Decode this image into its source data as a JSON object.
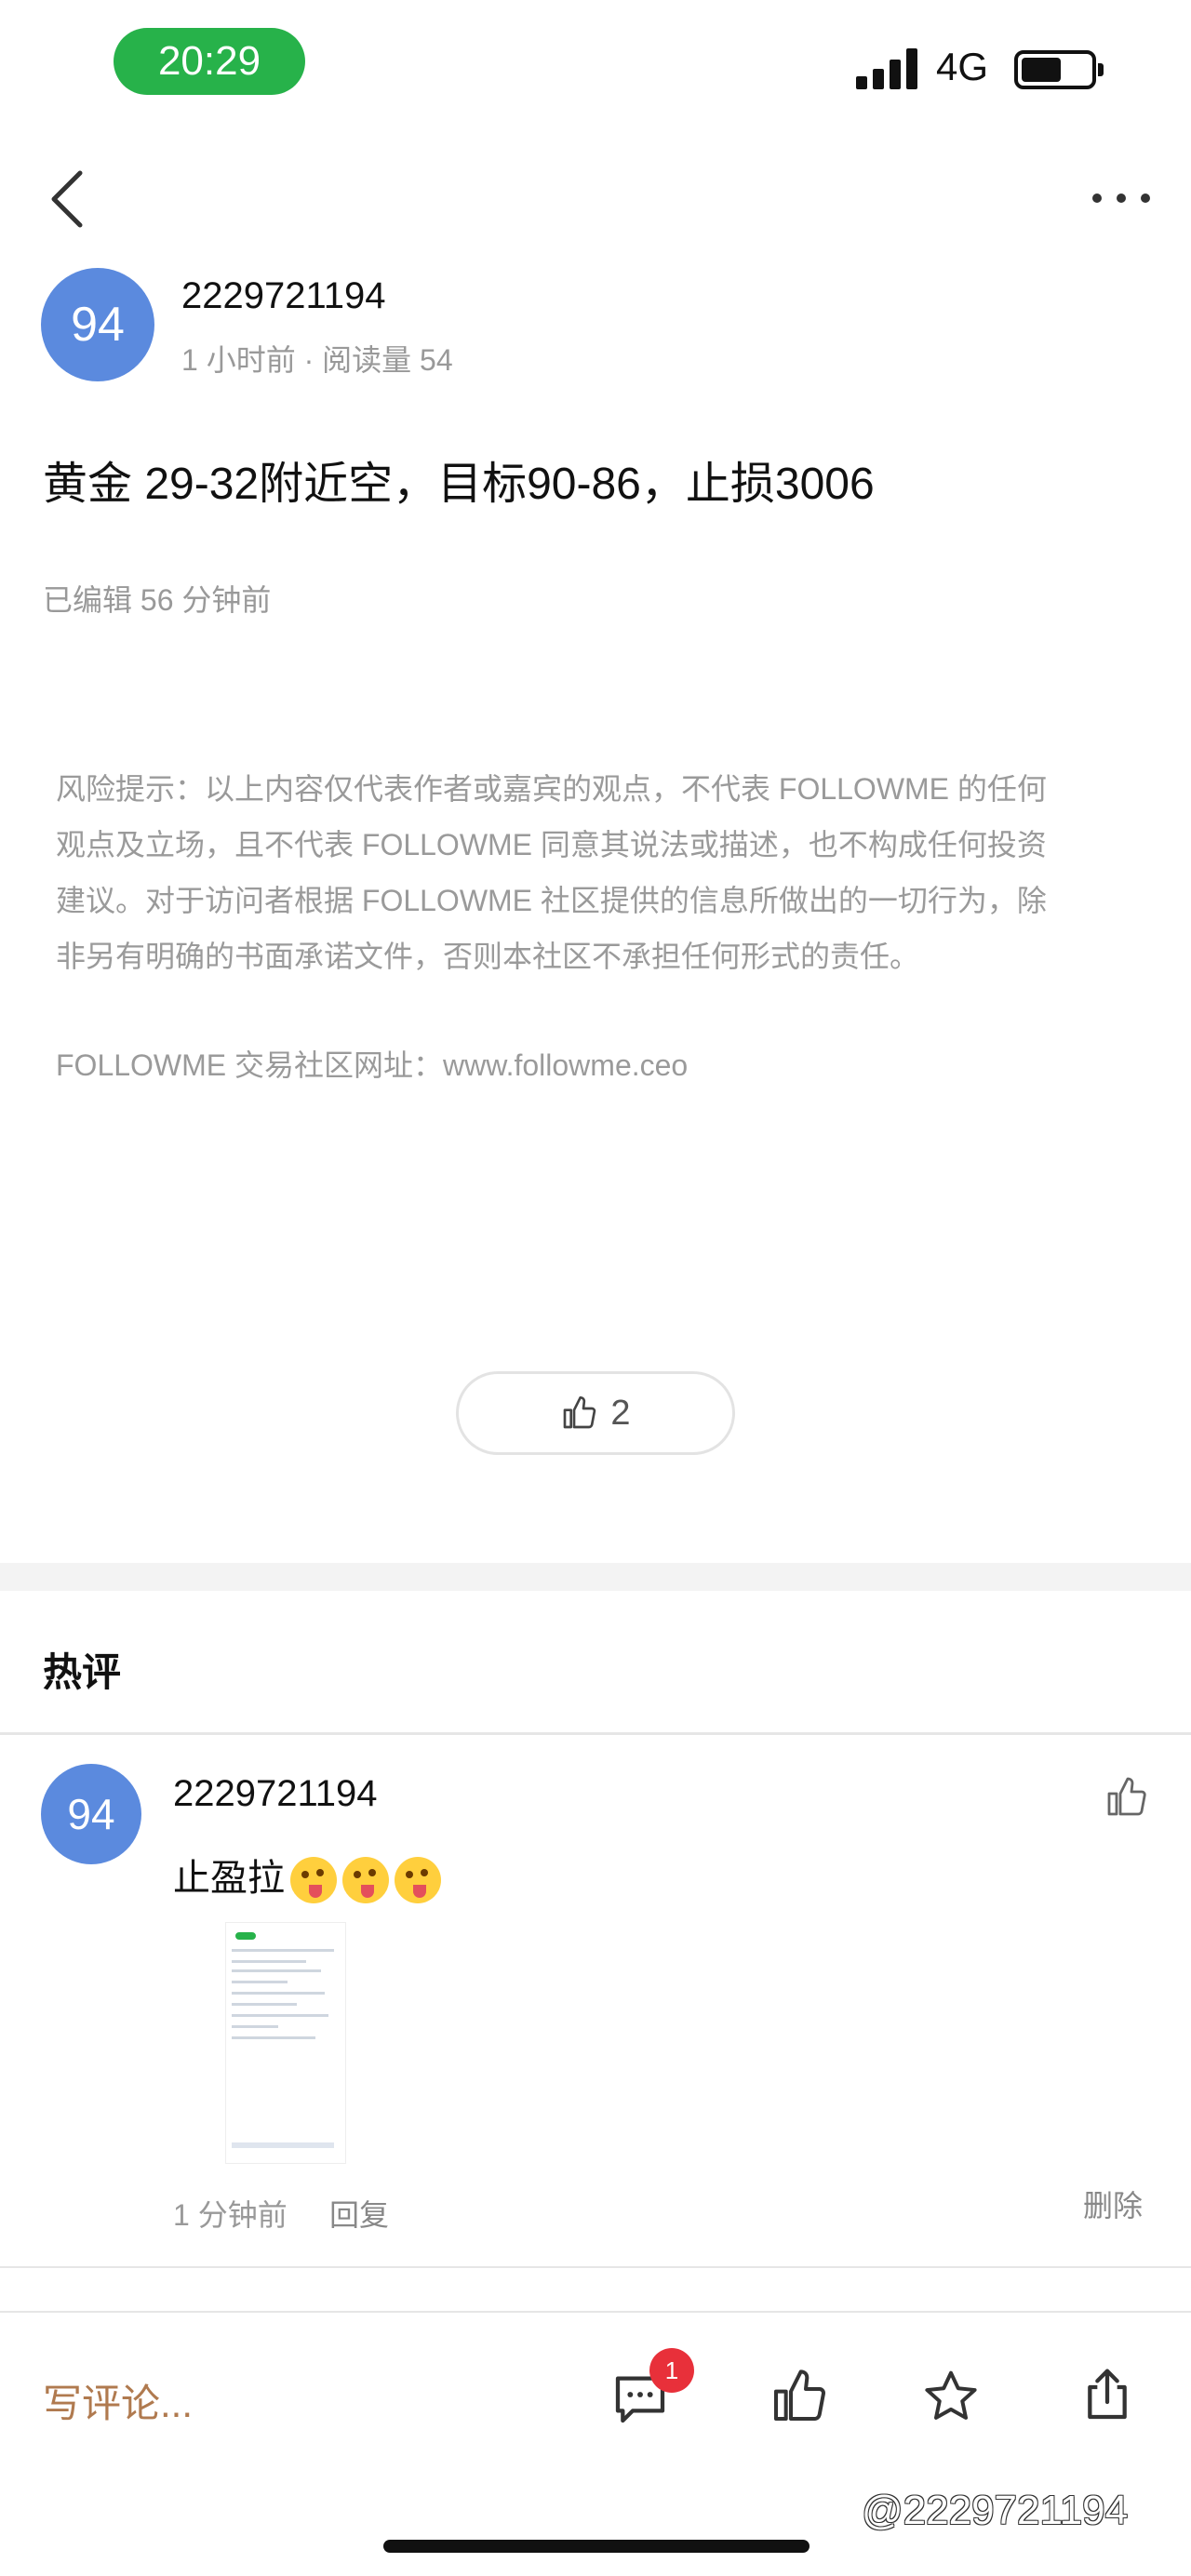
{
  "status_bar": {
    "time": "20:29",
    "network": "4G"
  },
  "post": {
    "avatar_text": "94",
    "author": "2229721194",
    "meta": "1 小时前 · 阅读量 54",
    "title": "黄金 29-32附近空，目标90-86，止损3006",
    "edited": "已编辑 56 分钟前",
    "disclaimer_lines": [
      "风险提示：以上内容仅代表作者或嘉宾的观点，不代表 FOLLOWME 的任何",
      "观点及立场，且不代表 FOLLOWME 同意其说法或描述，也不构成任何投资",
      "建议。对于访问者根据 FOLLOWME 社区提供的信息所做出的一切行为，除",
      "非另有明确的书面承诺文件，否则本社区不承担任何形式的责任。"
    ],
    "site": "FOLLOWME 交易社区网址：www.followme.ceo",
    "like_count": "2"
  },
  "hot_comments": {
    "title": "热评",
    "items": [
      {
        "avatar_text": "94",
        "author": "2229721194",
        "text": "止盈拉",
        "emoji_count": 3,
        "time": "1 分钟前",
        "reply_label": "回复",
        "delete_label": "删除"
      }
    ]
  },
  "bottom_bar": {
    "write_placeholder": "写评论...",
    "comment_badge": "1"
  },
  "watermark": "@2229721194",
  "icons": {
    "back": "chevron-left-icon",
    "more": "more-horizontal-icon",
    "like": "thumbs-up-icon",
    "comment": "comment-icon",
    "star": "star-icon",
    "share": "share-icon"
  },
  "colors": {
    "status_pill": "#27b24a",
    "avatar": "#5b8ade",
    "write_placeholder": "#b07a4f",
    "badge": "#e8303a"
  }
}
